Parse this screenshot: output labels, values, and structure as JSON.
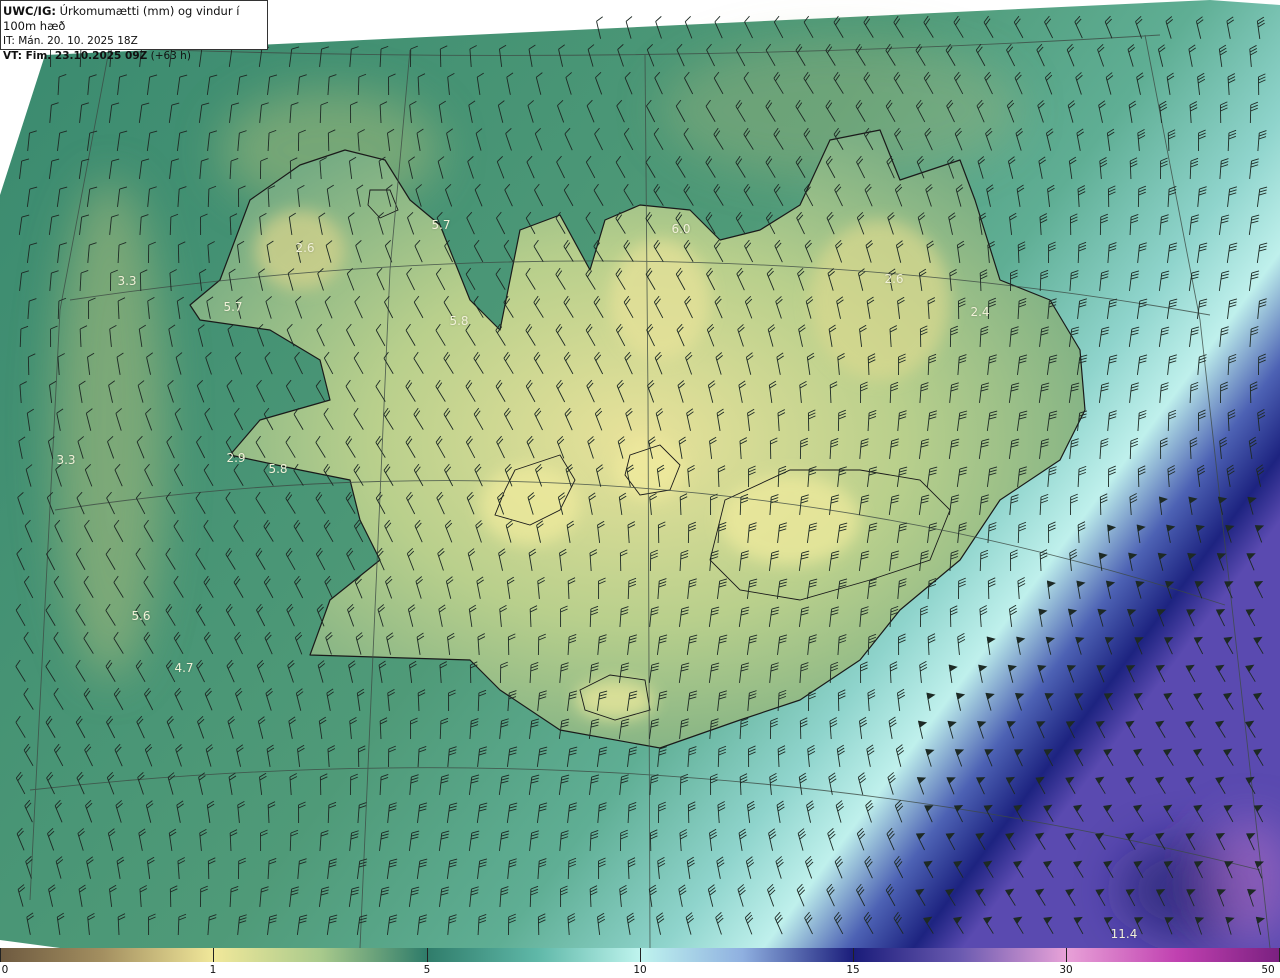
{
  "header": {
    "product": "UWC/IG:",
    "title": "Úrkomumætti (mm) og vindur í 100m hæð",
    "init_label": "IT:",
    "init_time": "Mán. 20. 10. 2025 18Z",
    "valid_label": "VT:",
    "valid_time": "Fim. 23.10.2025 09Z",
    "lead_time": "(+63 h)"
  },
  "map_labels": [
    "3.3",
    "2.6",
    "5.7",
    "5.7",
    "5.8",
    "6.0",
    "2.6",
    "2.4",
    "3.3",
    "2.9",
    "5.8",
    "5.6",
    "4.7",
    "11.4"
  ],
  "colorbar": {
    "ticks": [
      "0",
      "1",
      "5",
      "10",
      "15",
      "30",
      "50"
    ],
    "colors": [
      "#6e5a40",
      "#b3a06a",
      "#f1e89a",
      "#c9d891",
      "#6fae86",
      "#3f8a72",
      "#2f7c6a",
      "#5fb8a8",
      "#bff4ee",
      "#8fb0e0",
      "#4a5cb3",
      "#1a1c7a",
      "#5a3a9a",
      "#b86ac0",
      "#e8a2d8",
      "#c040b0",
      "#7a2080"
    ]
  },
  "icons": [
    "wind-barb-icon"
  ]
}
